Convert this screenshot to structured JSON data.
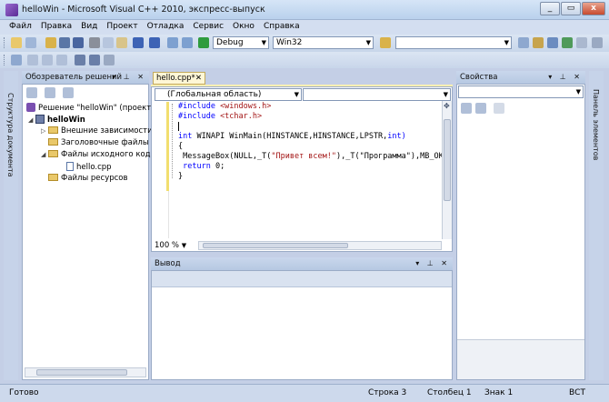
{
  "window": {
    "title": "helloWin - Microsoft Visual C++ 2010, экспресс-выпуск",
    "controls": [
      "_",
      "▭",
      "x"
    ]
  },
  "menu": [
    "Файл",
    "Правка",
    "Вид",
    "Проект",
    "Отладка",
    "Сервис",
    "Окно",
    "Справка"
  ],
  "toolbar": {
    "configuration": "Debug",
    "platform": "Win32",
    "search_value": ""
  },
  "solution_explorer": {
    "title": "Обозреватель решений",
    "items": [
      {
        "label": "Решение \"helloWin\" (проекто",
        "icon": "solution-icon"
      },
      {
        "label": "helloWin",
        "icon": "project-icon"
      },
      {
        "label": "Внешние зависимости",
        "icon": "folder-icon"
      },
      {
        "label": "Заголовочные файлы",
        "icon": "folder-icon"
      },
      {
        "label": "Файлы исходного кода",
        "icon": "folder-open-icon"
      },
      {
        "label": "hello.cpp",
        "icon": "cpp-file-icon"
      },
      {
        "label": "Файлы ресурсов",
        "icon": "folder-icon"
      }
    ]
  },
  "left_strip": {
    "label": "Структура документа"
  },
  "right_strip": {
    "label": "Панель элементов"
  },
  "editor": {
    "tab_label": "hello.cpp*",
    "scope": "(Глобальная область)",
    "member": "",
    "zoom": "100 %",
    "lines": [
      {
        "a": "#include ",
        "b": "<windows.h>",
        "c": ""
      },
      {
        "a": "#include ",
        "b": "<tchar.h>",
        "c": ""
      },
      {
        "a": "",
        "b": "",
        "c": ""
      },
      {
        "a": "int",
        "b": " WINAPI WinMain(HINSTANCE,HINSTANCE,LPSTR,",
        "c": "int)"
      },
      {
        "a": "{",
        "b": "",
        "c": ""
      },
      {
        "a": " MessageBox(NULL,_T(",
        "b": "\"Привет всем!\"",
        "c": "),_T(\"Программа\"),MB_OK);"
      },
      {
        "a": " return",
        "b": " 0;",
        "c": ""
      },
      {
        "a": "}",
        "b": "",
        "c": ""
      }
    ]
  },
  "output": {
    "title": "Вывод"
  },
  "properties": {
    "title": "Свойства"
  },
  "status": {
    "ready": "Готово",
    "line": "Строка 3",
    "column": "Столбец 1",
    "char": "Знак 1",
    "mode": "ВСТ"
  },
  "colors": {
    "keyword": "#0000ff",
    "string": "#a31515",
    "chrome": "#c4cfe6"
  }
}
